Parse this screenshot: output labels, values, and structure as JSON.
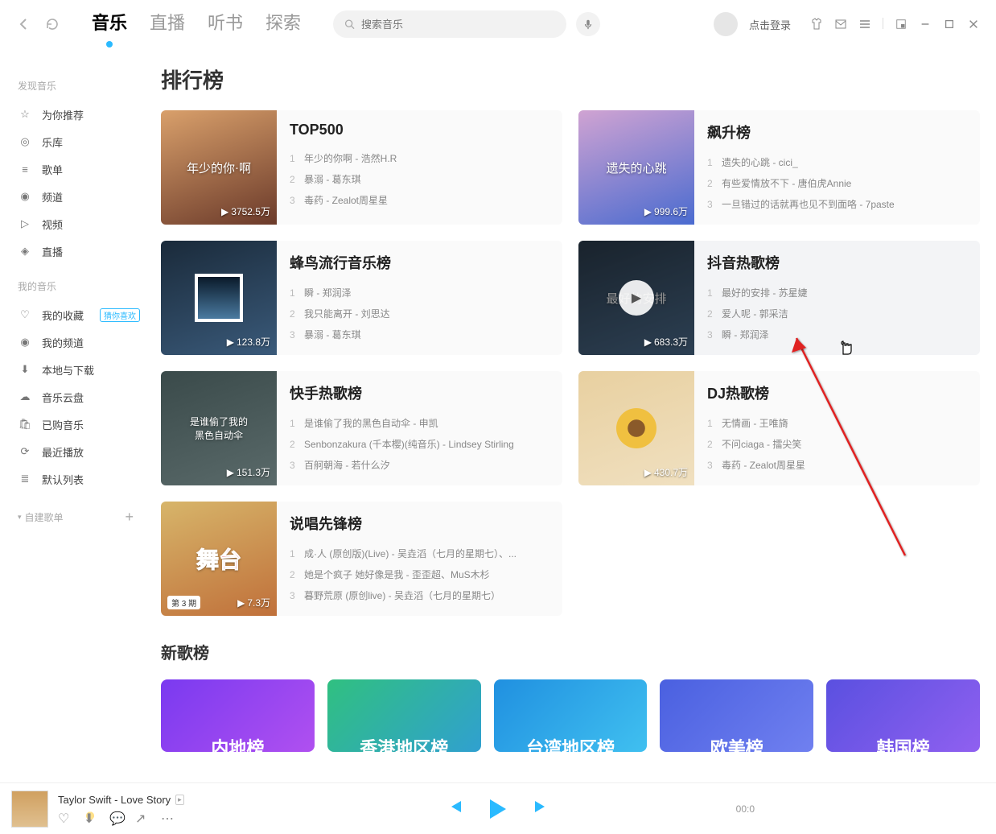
{
  "topbar": {
    "tabs": {
      "music": "音乐",
      "live": "直播",
      "listen": "听书",
      "explore": "探索"
    },
    "search_placeholder": "搜索音乐",
    "login": "点击登录"
  },
  "sidebar": {
    "section_discover": "发现音乐",
    "discover": {
      "recommend": "为你推荐",
      "library": "乐库",
      "playlist": "歌单",
      "channel": "频道",
      "video": "视频",
      "live": "直播"
    },
    "section_mine": "我的音乐",
    "mine": {
      "fav": "我的收藏",
      "fav_badge": "猜你喜欢",
      "my_channel": "我的频道",
      "local": "本地与下载",
      "cloud": "音乐云盘",
      "purchased": "已购音乐",
      "recent": "最近播放",
      "default_list": "默认列表"
    },
    "create": "自建歌单"
  },
  "main": {
    "title": "排行榜",
    "charts": [
      {
        "name": "TOP500",
        "plays": "3752.5万",
        "songs": [
          "年少的你啊 - 浩然H.R",
          "暴溺 - 葛东琪",
          "毒药 - Zealot周星星"
        ]
      },
      {
        "name": "飙升榜",
        "plays": "999.6万",
        "songs": [
          "遗失的心跳 - cici_",
          "有些爱情放不下 - 唐伯虎Annie",
          "一旦错过的话就再也见不到面咯 - 7paste"
        ]
      },
      {
        "name": "蜂鸟流行音乐榜",
        "plays": "123.8万",
        "songs": [
          "瞬 - 郑润泽",
          "我只能离开 - 刘思达",
          "暴溺 - 葛东琪"
        ]
      },
      {
        "name": "抖音热歌榜",
        "plays": "683.3万",
        "songs": [
          "最好的安排 - 苏星婕",
          "爱人呢 - 郭采洁",
          "瞬 - 郑润泽"
        ]
      },
      {
        "name": "快手热歌榜",
        "plays": "151.3万",
        "songs": [
          "是谁偷了我的黑色自动伞 - 申凯",
          "Senbonzakura (千本樱)(纯音乐) - Lindsey Stirling",
          "百舸朝海 - 若什么汐"
        ]
      },
      {
        "name": "DJ热歌榜",
        "plays": "430.7万",
        "songs": [
          "无情画 - 王唯旖",
          "不问ciaga - 擂尖笑",
          "毒药 - Zealot周星星"
        ]
      },
      {
        "name": "说唱先锋榜",
        "plays": "7.3万",
        "songs": [
          "成·人 (原创版)(Live) - 吴垚滔（七月的星期七）、...",
          "她是个疯子 她好像是我 - 歪歪超、MuS木杉",
          "暮野荒原 (原创live) - 吴垚滔（七月的星期七）"
        ]
      }
    ],
    "newsongs_title": "新歌榜",
    "regions": [
      "内地榜",
      "香港地区榜",
      "台湾地区榜",
      "欧美榜",
      "韩国榜"
    ],
    "cover_labels": {
      "c1": "年少的你·啊",
      "c2": "遗失的心跳",
      "c4": "最好的安排",
      "c5": "是谁偷了我的\n黑色自动伞",
      "c7_badge": "第 3 期"
    }
  },
  "player": {
    "song": "Taylor Swift - Love Story",
    "time": "00:0"
  }
}
